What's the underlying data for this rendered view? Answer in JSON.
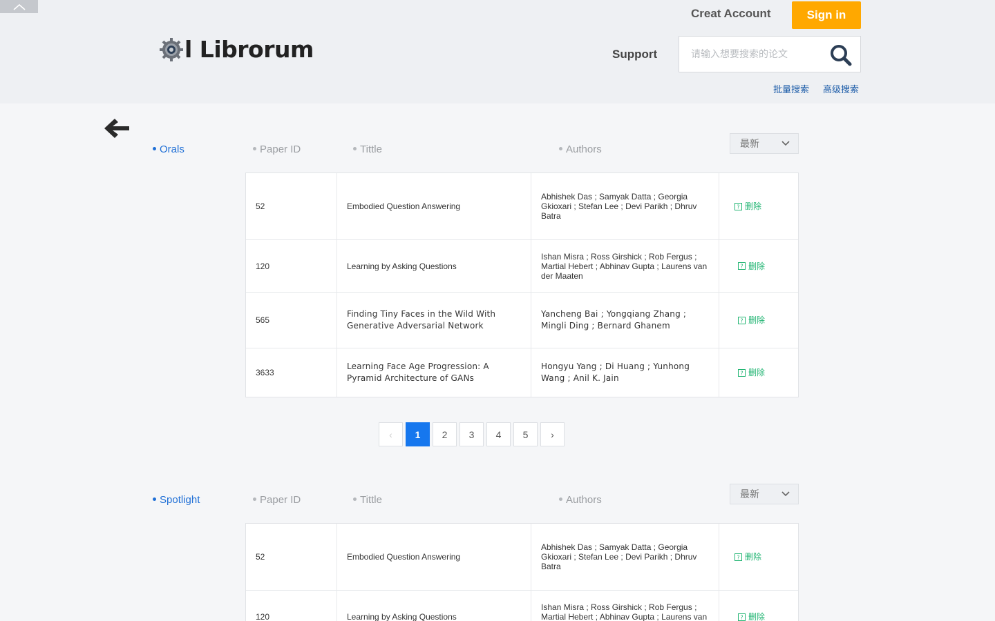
{
  "header": {
    "brand": "l Librorum",
    "creat_account": "Creat Account",
    "sign_in": "Sign in",
    "support": "Support",
    "search_placeholder": "请输入想要搜索的论文",
    "batch_search": "批量搜索",
    "advanced_search": "高级搜索",
    "accent_color": "#ffa800"
  },
  "columns": {
    "paper_id": "Paper ID",
    "title": "Tittle",
    "authors": "Authors",
    "sort_value": "最新"
  },
  "delete_label": "删除",
  "orals": {
    "label": "Orals",
    "rows": [
      {
        "id": "52",
        "title": "Embodied Question Answering",
        "authors": "Abhishek Das ; Samyak Datta ; Georgia Gkioxari ; Stefan Lee ; Devi Parikh ; Dhruv Batra"
      },
      {
        "id": "120",
        "title": "Learning by Asking Questions",
        "authors": "Ishan Misra ; Ross Girshick ; Rob Fergus ; Martial Hebert ; Abhinav Gupta ; Laurens van der Maaten"
      },
      {
        "id": "565",
        "title": "Finding Tiny Faces in the Wild With Generative Adversarial Network",
        "authors": "Yancheng Bai ; Yongqiang Zhang ; Mingli Ding ; Bernard Ghanem"
      },
      {
        "id": "3633",
        "title": "Learning Face Age Progression: A Pyramid Architecture of GANs",
        "authors": "Hongyu Yang ; Di Huang ; Yunhong Wang ; Anil K. Jain"
      }
    ]
  },
  "pagination": {
    "prev": "‹",
    "pages": [
      "1",
      "2",
      "3",
      "4",
      "5"
    ],
    "next": "›",
    "current": "1"
  },
  "spotlight": {
    "label": "Spotlight",
    "rows": [
      {
        "id": "52",
        "title": "Embodied Question Answering",
        "authors": "Abhishek Das ; Samyak Datta ; Georgia Gkioxari ; Stefan Lee ; Devi Parikh ; Dhruv Batra"
      },
      {
        "id": "120",
        "title": "Learning by Asking Questions",
        "authors": "Ishan Misra ; Ross Girshick ; Rob Fergus ; Martial Hebert ; Abhinav Gupta ; Laurens van der Maaten"
      }
    ]
  }
}
